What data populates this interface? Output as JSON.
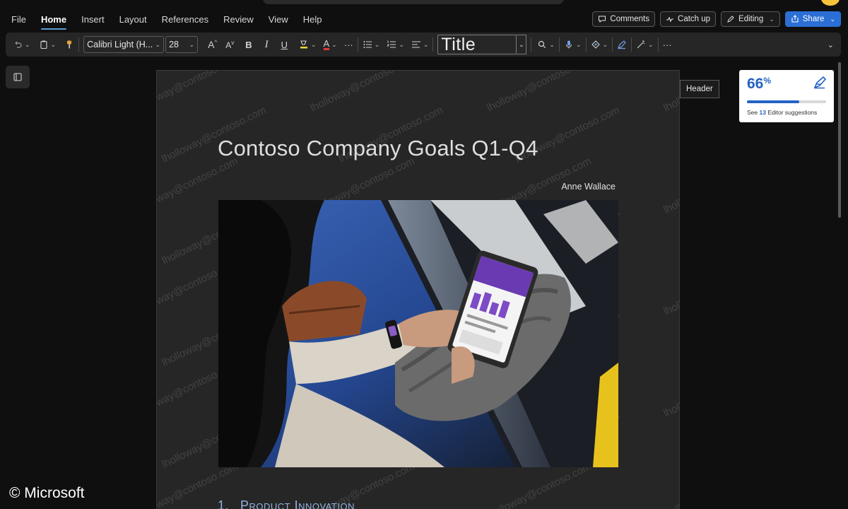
{
  "menu": {
    "items": [
      "File",
      "Home",
      "Insert",
      "Layout",
      "References",
      "Review",
      "View",
      "Help"
    ],
    "active": "Home"
  },
  "top_right": {
    "comments": "Comments",
    "catch_up": "Catch up",
    "editing": "Editing",
    "share": "Share"
  },
  "ribbon": {
    "font_name": "Calibri Light (H...",
    "font_size": "28",
    "style_name": "Title"
  },
  "document": {
    "title": "Contoso Company Goals Q1-Q4",
    "author": "Anne Wallace",
    "heading_number": "1.",
    "heading_text": "Product Innovation",
    "watermark": "lholloway@contoso.com",
    "image_alt": "person-using-phone-fitness-app"
  },
  "header_tag": "Header",
  "editor_card": {
    "score": "66",
    "score_unit": "%",
    "score_fraction": 0.66,
    "text_before": "See",
    "count": "13",
    "text_after": "Editor suggestions"
  },
  "copyright": "© Microsoft",
  "colors": {
    "accent": "#2b6fd6",
    "heading": "#8fb4e3",
    "background": "#0f0f0f",
    "page": "#262626"
  }
}
